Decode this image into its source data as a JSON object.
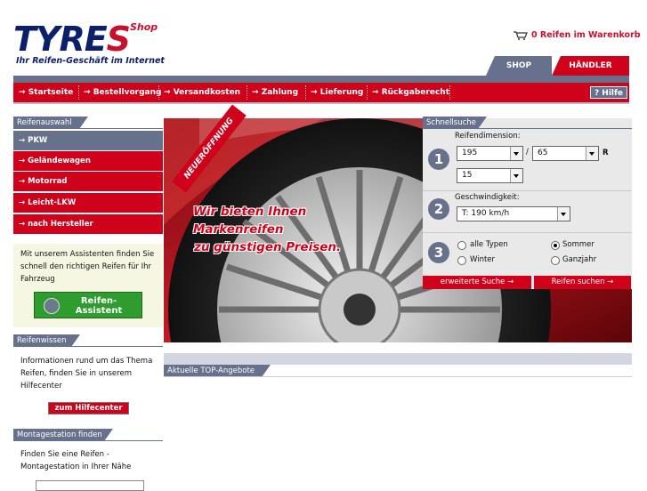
{
  "logo": {
    "brand_main": "TYRE",
    "brand_s": "S",
    "shop": "Shop",
    "slogan": "Ihr Reifen-Geschäft im Internet"
  },
  "cart": {
    "text": "0 Reifen im Warenkorb"
  },
  "tabs": [
    {
      "label": "SHOP"
    },
    {
      "label": "HÄNDLER"
    }
  ],
  "nav": {
    "items": [
      {
        "label": "Startseite"
      },
      {
        "label": "Bestellvorgang"
      },
      {
        "label": "Versandkosten"
      },
      {
        "label": "Zahlung"
      },
      {
        "label": "Lieferung"
      },
      {
        "label": "Rückgaberecht"
      }
    ],
    "help": "? Hilfe"
  },
  "sidebar": {
    "reifenauswahl_title": "Reifenauswahl",
    "categories": [
      {
        "label": "PKW"
      },
      {
        "label": "Geländewagen"
      },
      {
        "label": "Motorrad"
      },
      {
        "label": "Leicht-LKW"
      },
      {
        "label": "nach Hersteller"
      }
    ],
    "assistant_text": "Mit unserem Assistenten finden Sie schnell den richtigen Reifen für Ihr Fahrzeug",
    "assistant_button": "Reifen-Assistent",
    "reifenwissen_title": "Reifenwissen",
    "reifenwissen_text": "Informationen rund um das Thema Reifen, finden Sie in unserem Hilfecenter",
    "hilfecenter_button": "zum Hilfecenter",
    "montage_title": "Montagestation finden",
    "montage_text": "Finden Sie eine Reifen - Montagestation in Ihrer Nähe"
  },
  "hero": {
    "banner": "NEUERÖFFNUNG",
    "line1": "Wir bieten Ihnen Markenreifen",
    "line2": "zu günstigen Preisen."
  },
  "quicksearch": {
    "title": "Schnellsuche",
    "step1_label": "Reifendimension:",
    "width": "195",
    "slash": "/",
    "ratio": "65",
    "r": "R",
    "rim": "15",
    "step2_label": "Geschwindigkeit:",
    "speed": "T: 190 km/h",
    "season_options": [
      {
        "label": "alle Typen",
        "selected": false
      },
      {
        "label": "Sommer",
        "selected": true
      },
      {
        "label": "Winter",
        "selected": false
      },
      {
        "label": "Ganzjahr",
        "selected": false
      }
    ],
    "step_numbers": [
      "1",
      "2",
      "3"
    ],
    "extended_button": "erweiterte Suche",
    "search_button": "Reifen suchen"
  },
  "top_offers": {
    "title": "Aktuelle TOP-Angebote"
  },
  "colors": {
    "brand_red": "#d0021b",
    "brand_grey": "#68718c",
    "logo_blue": "#0b1f6b",
    "assistant_green": "#2e9c2e"
  }
}
